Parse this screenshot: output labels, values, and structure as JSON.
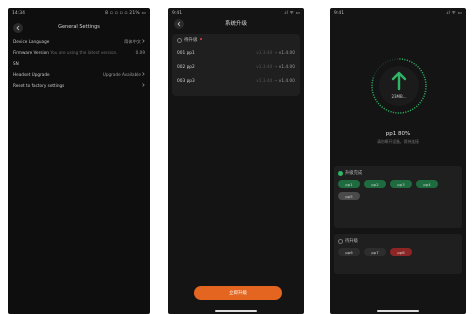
{
  "phone1": {
    "statusbar": {
      "time": "14:34",
      "right": "8 ▫ ▫ ▫ ▫ 21% ▭"
    },
    "title": "General Settings",
    "rows": [
      {
        "label": "Device Language",
        "value": "简体中文"
      },
      {
        "label": "Firmware Version",
        "note": "You are using the latest version.",
        "value": "0.09"
      },
      {
        "label": "SN",
        "value": ""
      },
      {
        "label": "Headset Upgrade",
        "value": "Upgrade Available"
      },
      {
        "label": "Reset to factory settings",
        "value": ""
      }
    ]
  },
  "phone2": {
    "statusbar": {
      "time": "9:41",
      "right": ".ıl ᯤ ▭"
    },
    "title": "系统升级",
    "card_title": "待升级",
    "items": [
      {
        "name": "001 pp1",
        "from": "v1.3.44",
        "to": "v1.4.00"
      },
      {
        "name": "002 pp2",
        "from": "v1.3.44",
        "to": "v1.4.00"
      },
      {
        "name": "003 pp3",
        "from": "v1.3.44",
        "to": "v1.4.00"
      }
    ],
    "upgrade_button": "立即升级",
    "accent": "#e3651f"
  },
  "phone3": {
    "statusbar": {
      "time": "9:41",
      "right": ".ıl ᯤ ▭"
    },
    "ring_text": "23MB...",
    "progress": 0.8,
    "progress_label": "pp1 80%",
    "progress_sub": "请勿断开设备，保持连接",
    "done_title": "升级完成",
    "done_chips": [
      "pp1",
      "pp2",
      "pp3",
      "pp4",
      "pp5"
    ],
    "pending_title": "待升级",
    "pending_chips": [
      "pp6",
      "pp7",
      "pp8"
    ],
    "accent": "#2fb565"
  }
}
